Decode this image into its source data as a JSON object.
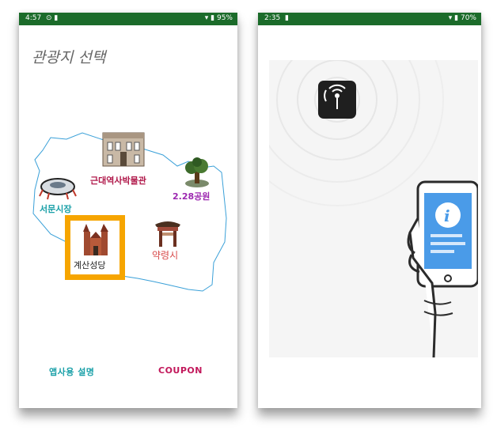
{
  "left_screen": {
    "status": {
      "time": "4:57",
      "battery": "95%",
      "icons": "⊙ ▮"
    },
    "title": "관광지 선택",
    "pois": [
      {
        "label": "근대역사박물관",
        "color": "#b0184a"
      },
      {
        "label": "2.28공원",
        "color": "#9c27b0"
      },
      {
        "label": "서문시장",
        "color": "#1aa0a8"
      },
      {
        "label": "약령시",
        "color": "#d84a4a"
      },
      {
        "label": "계산성당",
        "color": "#222222"
      }
    ],
    "bottom": {
      "help_label": "앱사용 설명",
      "coupon_label": "COUPON"
    },
    "colors": {
      "status_bar": "#1b6b2a",
      "selection_border": "#f6a500",
      "map_outline": "#3aa0d8"
    }
  },
  "right_screen": {
    "status": {
      "time": "2:35",
      "battery": "70%",
      "icons": "▮"
    },
    "icons": [
      "beacon-app-icon",
      "info-icon"
    ],
    "colors": {
      "status_bar": "#1b6b2a",
      "info_blue": "#4a9be8"
    }
  }
}
